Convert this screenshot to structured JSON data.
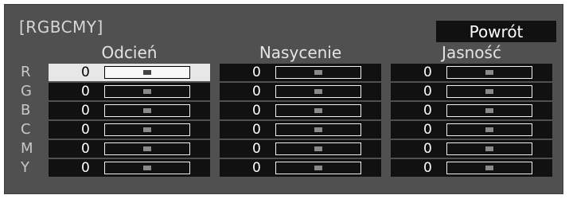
{
  "title": "[RGBCMY]",
  "back_button": "Powrót",
  "columns": [
    {
      "key": "hue",
      "label": "Odcień"
    },
    {
      "key": "saturation",
      "label": "Nasycenie"
    },
    {
      "key": "brightness",
      "label": "Jasność"
    }
  ],
  "rows": [
    {
      "letter": "R",
      "values": [
        "0",
        "0",
        "0"
      ]
    },
    {
      "letter": "G",
      "values": [
        "0",
        "0",
        "0"
      ]
    },
    {
      "letter": "B",
      "values": [
        "0",
        "0",
        "0"
      ]
    },
    {
      "letter": "C",
      "values": [
        "0",
        "0",
        "0"
      ]
    },
    {
      "letter": "M",
      "values": [
        "0",
        "0",
        "0"
      ]
    },
    {
      "letter": "Y",
      "values": [
        "0",
        "0",
        "0"
      ]
    }
  ],
  "slider_range": [
    -50,
    50
  ],
  "selected": {
    "row": 0,
    "col": 0
  },
  "colors": {
    "panel": "#505050",
    "cell": "#111111",
    "selected_cell": "#e7e7e7",
    "text": "#e4e4e4"
  }
}
